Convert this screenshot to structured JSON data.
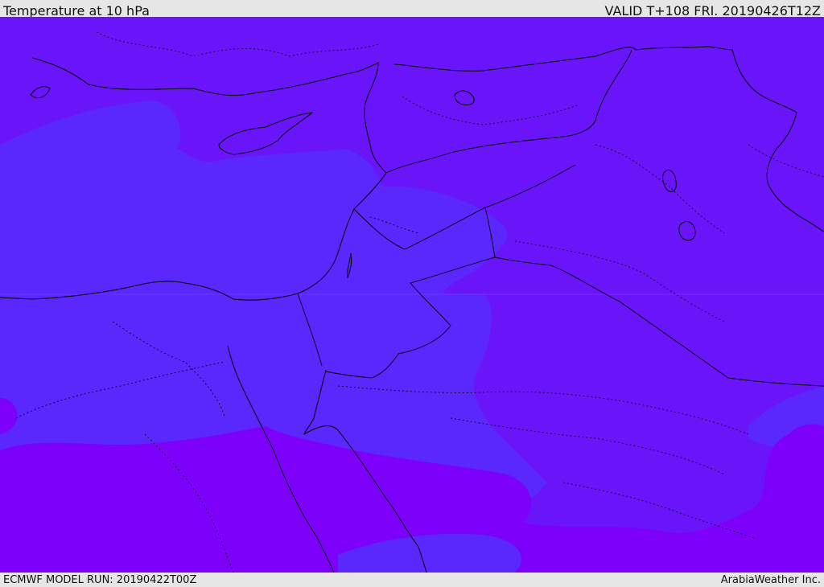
{
  "header": {
    "title": "Temperature at 10 hPa",
    "valid": "VALID T+108 FRI. 20190426T12Z"
  },
  "footer": {
    "model_run": "ECMWF MODEL RUN: 20190422T00Z",
    "credit": "ArabiaWeather Inc."
  },
  "colors": {
    "band_violet": "#6a14fa",
    "band_blue": "#5a27fd",
    "band_purple": "#7d00fb",
    "border_line": "#000000",
    "frame": "#e6e6e6"
  }
}
